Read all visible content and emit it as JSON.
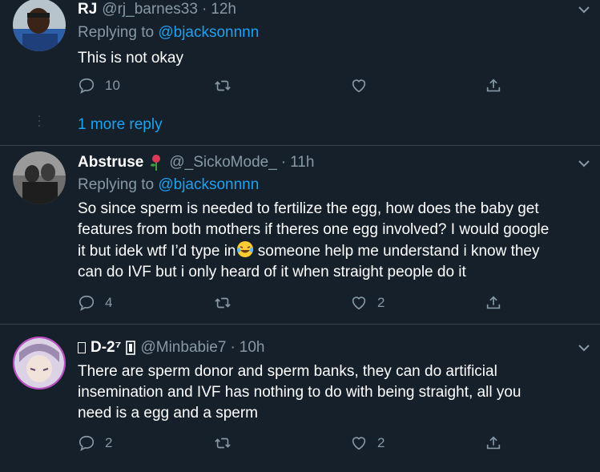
{
  "tweets": [
    {
      "display_name": "RJ",
      "handle": "@rj_barnes33",
      "dot": "·",
      "timestamp": "12h",
      "replying_prefix": "Replying to",
      "replying_to": "@bjacksonnnn",
      "text": "This is not okay",
      "reply_count": "10",
      "retweet_count": "",
      "like_count": ""
    },
    {
      "display_name": "Abstruse",
      "handle": "@_SickoMode_",
      "dot": "·",
      "timestamp": "11h",
      "replying_prefix": "Replying to",
      "replying_to": "@bjacksonnnn",
      "text_lines": [
        "So since sperm is needed to fertilize the egg, how does the baby get",
        "features from both mothers if theres one egg involved? I would google",
        "it but idek wtf I’d type in",
        " someone help me understand i know they",
        "can do IVF but i only heard of it when straight people do it"
      ],
      "reply_count": "4",
      "retweet_count": "",
      "like_count": "2"
    },
    {
      "display_name": "D-2⁷",
      "handle": "@Minbabie7",
      "dot": "·",
      "timestamp": "10h",
      "text_lines": [
        "There are sperm donor and sperm banks, they can do artificial",
        "insemination and IVF has nothing to do with being straight, all you",
        "need is a egg and a sperm"
      ],
      "reply_count": "2",
      "retweet_count": "",
      "like_count": "2"
    }
  ],
  "more_replies": "1 more reply",
  "icons": {
    "reply": "reply-icon",
    "retweet": "retweet-icon",
    "like": "heart-icon",
    "share": "share-icon",
    "menu": "chevron-down-icon",
    "emoji": "laughing-tears-emoji",
    "flower": "rose-emoji"
  },
  "colors": {
    "background": "#15202b",
    "link": "#1da1f2",
    "muted": "#8899a6",
    "divider": "#38444d"
  }
}
